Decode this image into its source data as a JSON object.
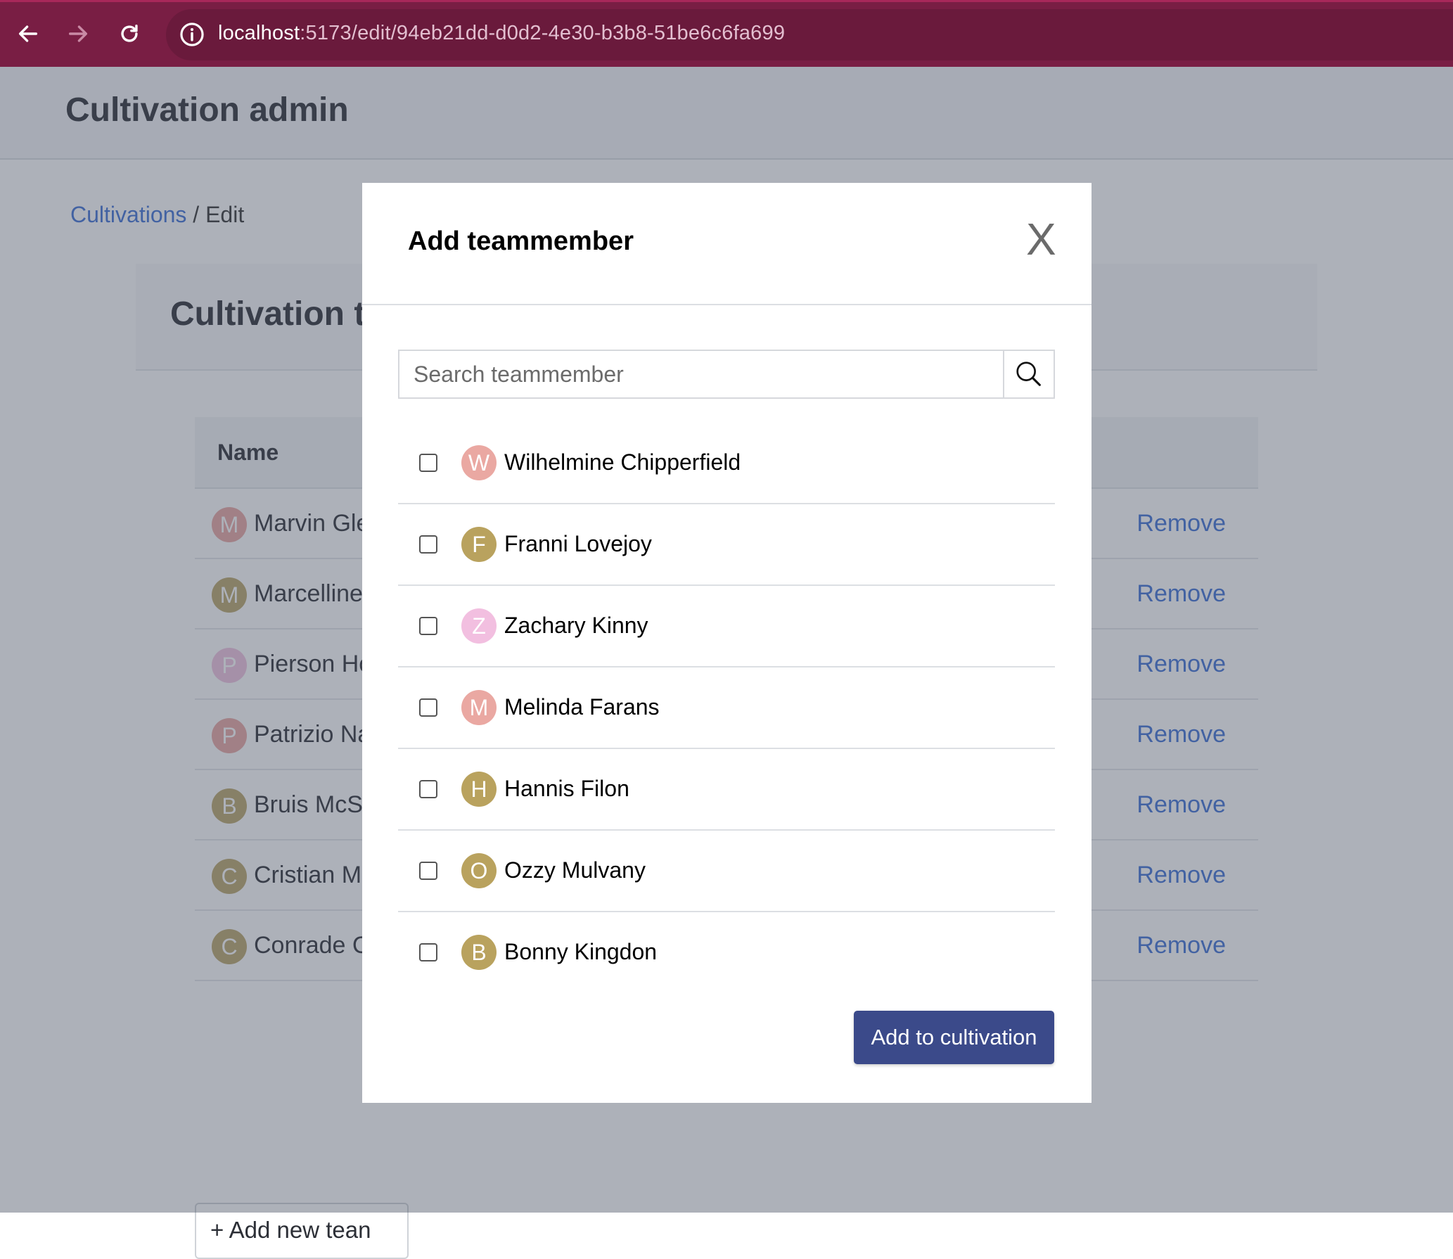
{
  "browser": {
    "url_host": "localhost",
    "url_path": ":5173/edit/94eb21dd-d0d2-4e30-b3b8-51be6c6fa699"
  },
  "app": {
    "title": "Cultivation admin"
  },
  "breadcrumb": {
    "link": "Cultivations",
    "separator": " / ",
    "current": "Edit"
  },
  "card": {
    "title": "Cultivation t",
    "table_header_name": "Name",
    "rows": [
      {
        "initial": "M",
        "name": "Marvin Gle",
        "action": "Remove",
        "color": "#e9a6a2"
      },
      {
        "initial": "M",
        "name": "Marcelline",
        "action": "Remove",
        "color": "#bba66a"
      },
      {
        "initial": "P",
        "name": "Pierson Ho",
        "action": "Remove",
        "color": "#f1c3e0"
      },
      {
        "initial": "P",
        "name": "Patrizio Na",
        "action": "Remove",
        "color": "#e9a6a2"
      },
      {
        "initial": "B",
        "name": "Bruis McSk",
        "action": "Remove",
        "color": "#bba66a"
      },
      {
        "initial": "C",
        "name": "Cristian Mu",
        "action": "Remove",
        "color": "#bba66a"
      },
      {
        "initial": "C",
        "name": "Conrade C",
        "action": "Remove",
        "color": "#bba66a"
      }
    ],
    "add_button": "+ Add new tean"
  },
  "modal": {
    "title": "Add teammember",
    "close_label": "X",
    "search_placeholder": "Search teammember",
    "members": [
      {
        "initial": "W",
        "name": "Wilhelmine Chipperfield",
        "checked": false,
        "color": "#eaa8a2"
      },
      {
        "initial": "F",
        "name": "Franni Lovejoy",
        "checked": false,
        "color": "#b9a25e"
      },
      {
        "initial": "Z",
        "name": "Zachary Kinny",
        "checked": false,
        "color": "#f2bfe0"
      },
      {
        "initial": "M",
        "name": "Melinda Farans",
        "checked": false,
        "color": "#eaa8a2"
      },
      {
        "initial": "H",
        "name": "Hannis Filon",
        "checked": false,
        "color": "#b9a25e"
      },
      {
        "initial": "O",
        "name": "Ozzy Mulvany",
        "checked": false,
        "color": "#b9a25e"
      },
      {
        "initial": "B",
        "name": "Bonny Kingdon",
        "checked": false,
        "color": "#b9a25e"
      }
    ],
    "submit_label": "Add to cultivation"
  },
  "icons": {
    "back": "arrow-left-icon",
    "forward": "arrow-right-icon",
    "reload": "reload-icon",
    "site_info": "info-icon",
    "search": "search-icon"
  },
  "colors": {
    "browser_bar": "#791e44",
    "link": "#3d6fd6",
    "primary_button": "#3b4a8a"
  }
}
